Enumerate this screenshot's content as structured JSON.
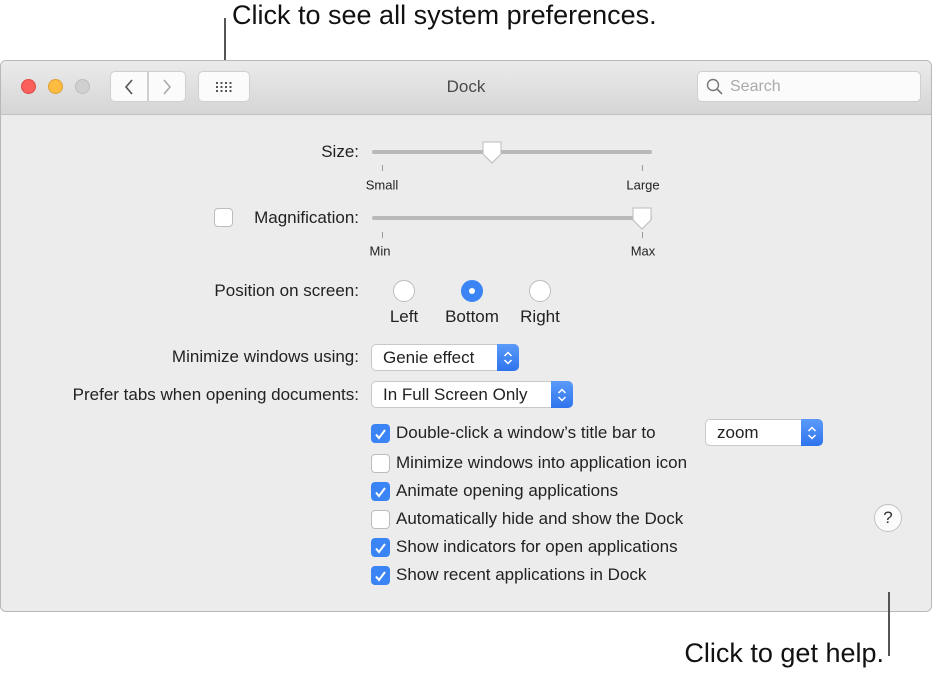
{
  "callouts": {
    "top": "Click to see all system preferences.",
    "bottom": "Click to get help."
  },
  "window": {
    "title": "Dock",
    "search_placeholder": "Search"
  },
  "colors": {
    "accent": "#3b84f5",
    "close": "#fc605c",
    "minimize": "#fdbc40",
    "zoom_disabled": "#d0d0d0"
  },
  "size": {
    "label": "Size:",
    "min_label": "Small",
    "max_label": "Large",
    "value_fraction": 0.43
  },
  "magnification": {
    "label": "Magnification:",
    "checked": false,
    "min_label": "Min",
    "max_label": "Max",
    "value_fraction": 1.0
  },
  "position": {
    "label": "Position on screen:",
    "options": [
      "Left",
      "Bottom",
      "Right"
    ],
    "selected": "Bottom"
  },
  "minimize": {
    "label": "Minimize windows using:",
    "value": "Genie effect"
  },
  "prefer_tabs": {
    "label": "Prefer tabs when opening documents:",
    "value": "In Full Screen Only"
  },
  "double_click": {
    "label": "Double-click a window’s title bar to",
    "checked": true,
    "value": "zoom"
  },
  "options": [
    {
      "label": "Minimize windows into application icon",
      "checked": false
    },
    {
      "label": "Animate opening applications",
      "checked": true
    },
    {
      "label": "Automatically hide and show the Dock",
      "checked": false
    },
    {
      "label": "Show indicators for open applications",
      "checked": true
    },
    {
      "label": "Show recent applications in Dock",
      "checked": true
    }
  ],
  "help": {
    "label": "?"
  }
}
